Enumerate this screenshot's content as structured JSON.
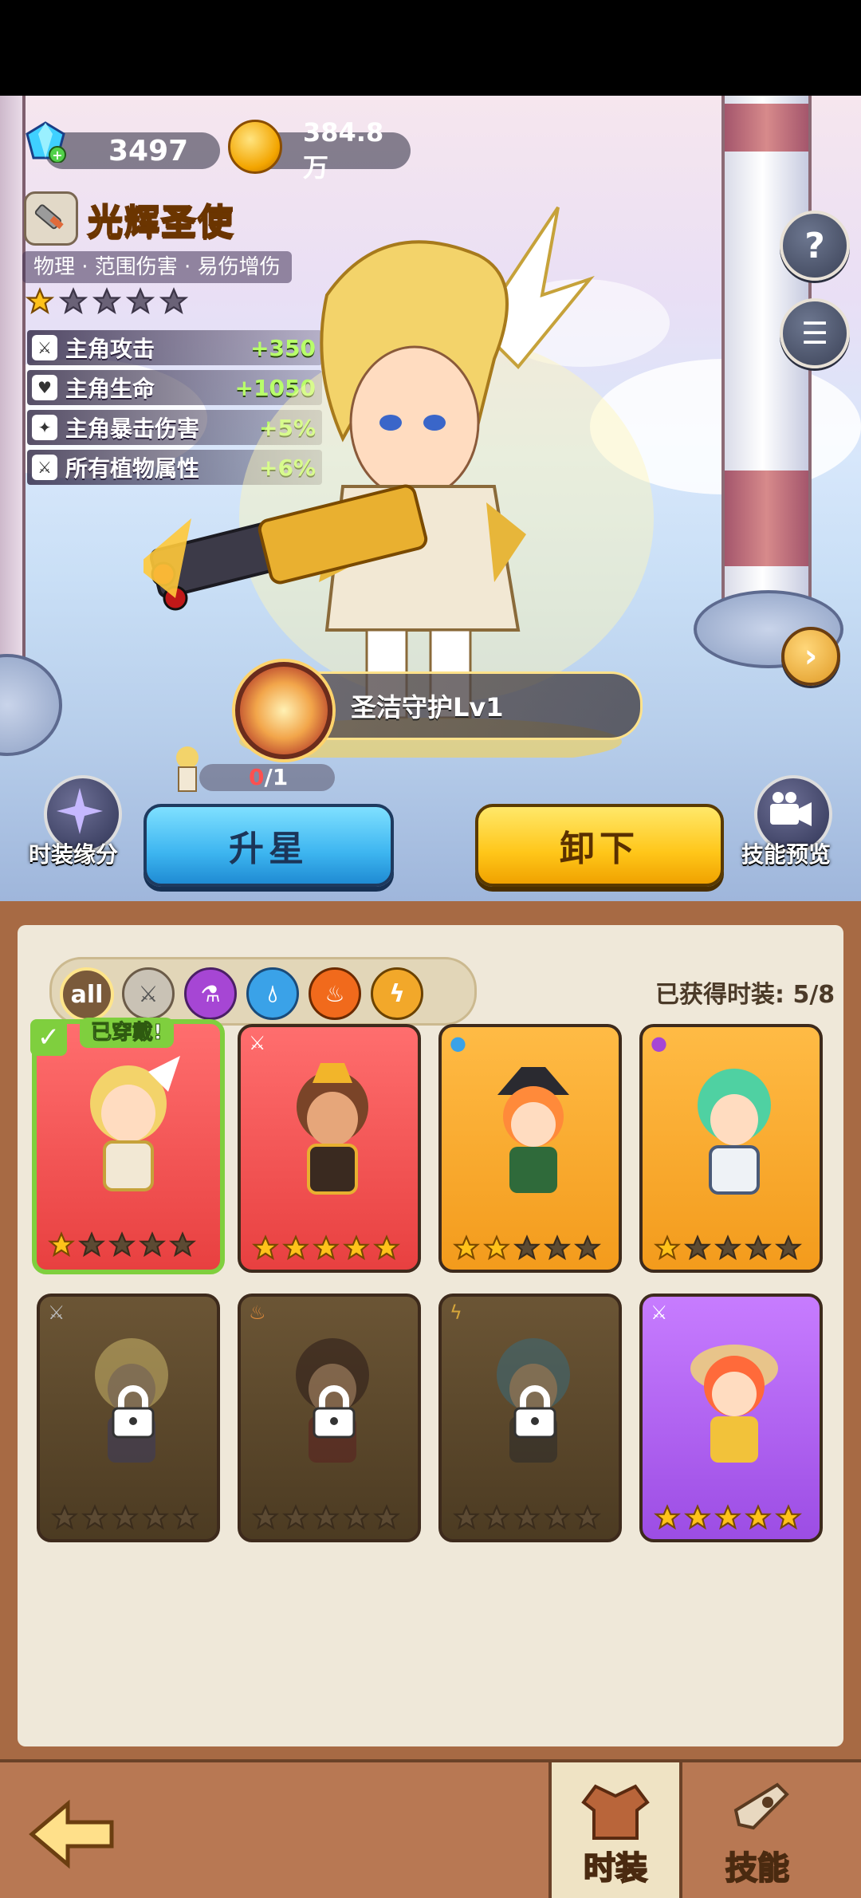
{
  "currency": {
    "gems": "3497",
    "coins": "384.8万"
  },
  "hero": {
    "name": "光辉圣使",
    "tags": "物理 · 范围伤害 · 易伤增伤",
    "stars_filled": 1,
    "stars_total": 5,
    "stats": [
      {
        "label": "主角攻击",
        "value": "+350"
      },
      {
        "label": "主角生命",
        "value": "+1050"
      },
      {
        "label": "主角暴击伤害",
        "value": "+5%"
      },
      {
        "label": "所有植物属性",
        "value": "+6%"
      }
    ],
    "skill": "圣洁守护Lv1",
    "fragments_current": "0",
    "fragments_total": "/1"
  },
  "buttons": {
    "star_up": "升星",
    "unequip": "卸下",
    "costume_bond": "时装缘分",
    "skill_preview": "技能预览"
  },
  "filters": [
    "all",
    "sword",
    "potion",
    "water",
    "fire",
    "lightning"
  ],
  "owned_label": "已获得时装: 5/8",
  "worn_label": "已穿戴!",
  "cards": [
    {
      "color": "red",
      "element": "sword",
      "stars": 1,
      "locked": false,
      "worn": true
    },
    {
      "color": "red",
      "element": "sword",
      "stars": 5,
      "locked": false,
      "worn": false
    },
    {
      "color": "orange",
      "element": "water",
      "stars": 2,
      "locked": false,
      "worn": false
    },
    {
      "color": "orange",
      "element": "potion",
      "stars": 1,
      "locked": false,
      "worn": false
    },
    {
      "color": "locked",
      "element": "sword",
      "stars": 0,
      "locked": true,
      "worn": false
    },
    {
      "color": "locked",
      "element": "fire",
      "stars": 0,
      "locked": true,
      "worn": false
    },
    {
      "color": "locked",
      "element": "lightning",
      "stars": 0,
      "locked": true,
      "worn": false
    },
    {
      "color": "purple",
      "element": "sword",
      "stars": 5,
      "locked": false,
      "worn": false
    }
  ],
  "nav": {
    "costume": "时装",
    "skills": "技能"
  },
  "colors": {
    "stat_value": "#b8ff6a",
    "star_gold": "#ffc21a",
    "worn_green": "#7fcf3e"
  }
}
